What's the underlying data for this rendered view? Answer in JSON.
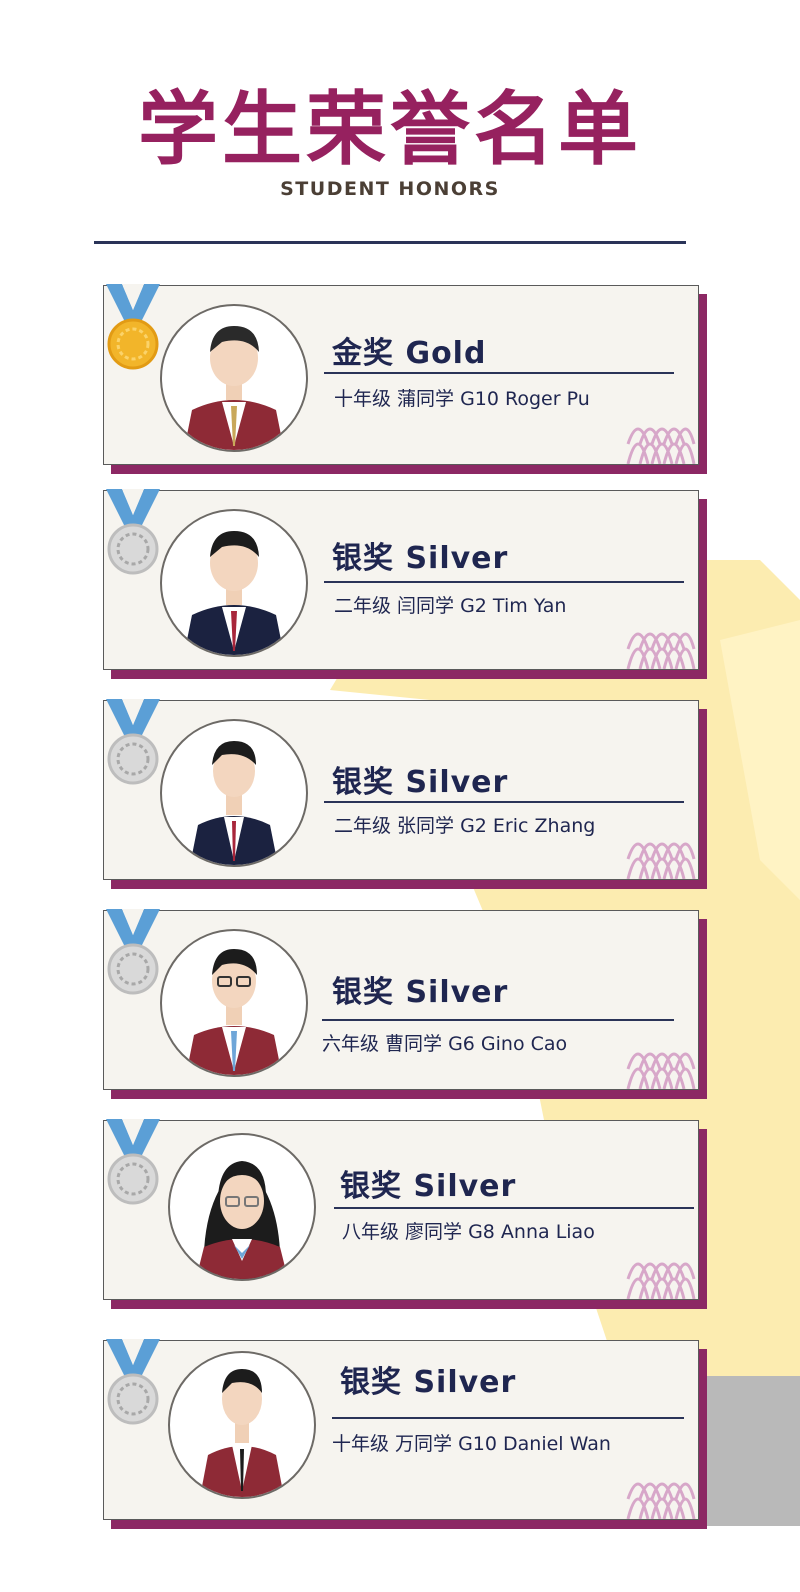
{
  "header": {
    "title_cn": "学生荣誉名单",
    "title_en": "STUDENT HONORS"
  },
  "colors": {
    "brand": "#96215f",
    "navy": "#1f2650",
    "card_shadow": "#8c2864",
    "card_bg": "#f6f4ef",
    "ribbon_blue": "#5b9fd6",
    "gold": "#f2b52a",
    "silver": "#c9c9c9",
    "star_yellow": "#fcecb0"
  },
  "honors": [
    {
      "award": "金奖 Gold",
      "medal": "gold-medal-icon",
      "student": "十年级 蒲同学 G10 Roger Pu",
      "uniform": "red-striped-blazer"
    },
    {
      "award": "银奖 Silver",
      "medal": "silver-medal-icon",
      "student": "二年级 闫同学 G2 Tim Yan",
      "uniform": "navy-blazer"
    },
    {
      "award": "银奖 Silver",
      "medal": "silver-medal-icon",
      "student": "二年级 张同学 G2 Eric Zhang",
      "uniform": "navy-blazer"
    },
    {
      "award": "银奖 Silver",
      "medal": "silver-medal-icon",
      "student": "六年级 曹同学 G6 Gino Cao",
      "uniform": "red-striped-blazer"
    },
    {
      "award": "银奖 Silver",
      "medal": "silver-medal-icon",
      "student": "八年级 廖同学 G8 Anna Liao",
      "uniform": "red-striped-blazer"
    },
    {
      "award": "银奖 Silver",
      "medal": "silver-medal-icon",
      "student": "十年级 万同学 G10 Daniel Wan",
      "uniform": "red-striped-blazer"
    }
  ]
}
